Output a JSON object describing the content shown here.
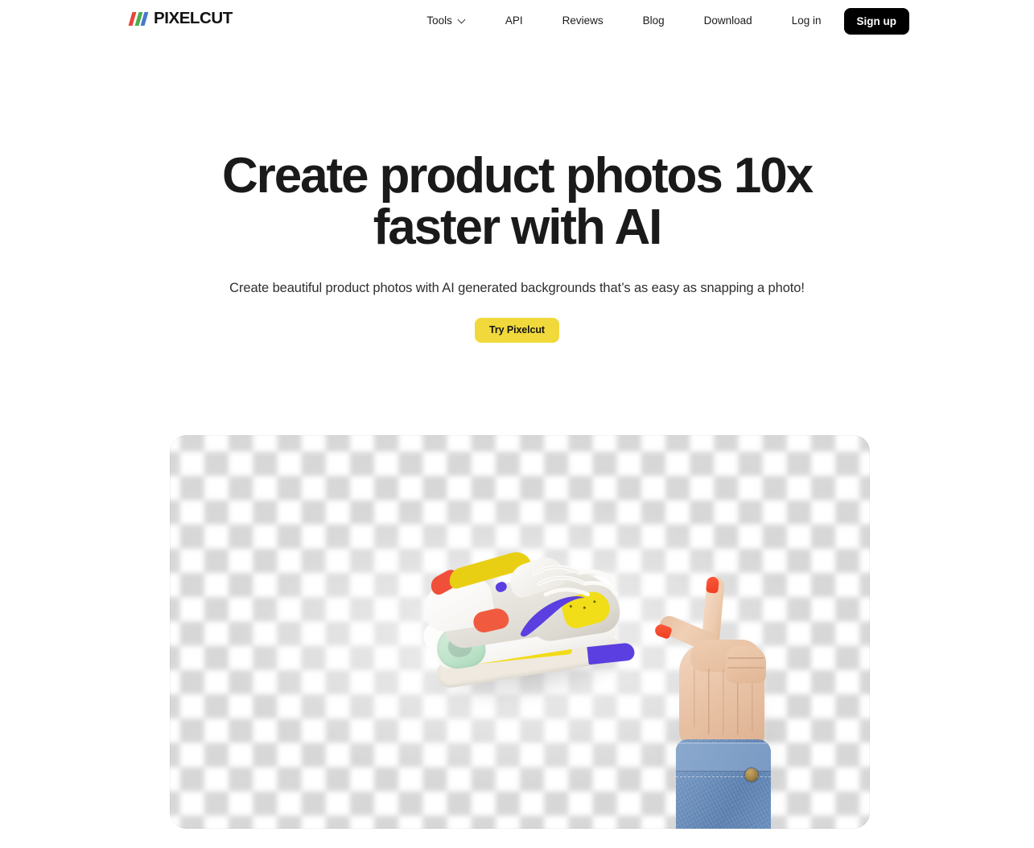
{
  "header": {
    "brand": {
      "name": "PIXELCUT",
      "logo_colors": [
        "#E8453C",
        "#4BAE4F",
        "#4878D0"
      ]
    },
    "nav": [
      {
        "label": "Tools",
        "has_dropdown": true
      },
      {
        "label": "API",
        "has_dropdown": false
      },
      {
        "label": "Reviews",
        "has_dropdown": false
      },
      {
        "label": "Blog",
        "has_dropdown": false
      },
      {
        "label": "Download",
        "has_dropdown": false
      },
      {
        "label": "Log in",
        "has_dropdown": false
      }
    ],
    "signup_label": "Sign up",
    "signup_bg": "#000000"
  },
  "hero": {
    "title": "Create product photos 10x faster with AI",
    "subtitle": "Create beautiful product photos with AI generated backgrounds that’s as easy as snapping a photo!",
    "cta_label": "Try Pixelcut",
    "cta_bg": "#F1D93B",
    "cta_text_color": "#151515"
  },
  "showcase": {
    "alt": "Sneaker and pointing hand on transparent checkerboard background",
    "checker_light": "#FFFFFF",
    "checker_dark": "#D7D7D7",
    "objects": [
      {
        "name": "sneaker",
        "description": "White and grey Nike Air Max with purple swoosh, yellow midsole accents and red heel patch"
      },
      {
        "name": "pointing-hand",
        "description": "Hand pointing upward with red nail polish wearing a blue denim shirt cuff"
      }
    ]
  }
}
